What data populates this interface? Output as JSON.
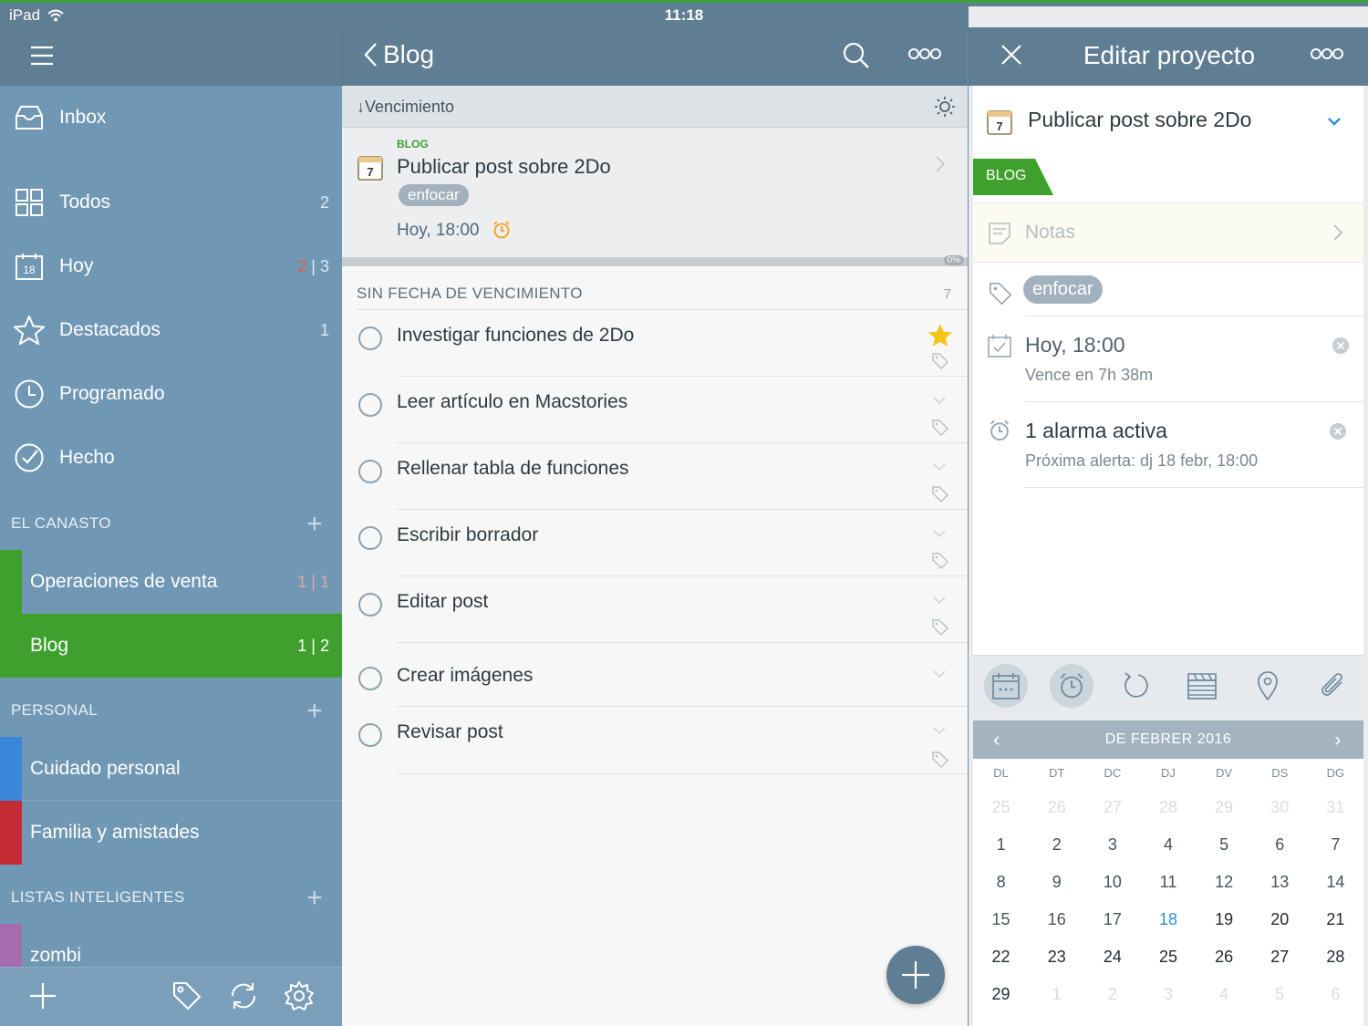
{
  "status": {
    "device": "iPad",
    "time": "11:18"
  },
  "sidebar": {
    "items": [
      {
        "label": "Inbox",
        "count": ""
      },
      {
        "label": "Todos",
        "count": "2"
      },
      {
        "label": "Hoy",
        "count_red": "2",
        "count": "3",
        "icon_text": "18"
      },
      {
        "label": "Destacados",
        "count": "1"
      },
      {
        "label": "Programado",
        "count": ""
      },
      {
        "label": "Hecho",
        "count": ""
      }
    ],
    "sections": [
      {
        "title": "EL CANASTO"
      },
      {
        "title": "PERSONAL"
      },
      {
        "title": "LISTAS INTELIGENTES"
      }
    ],
    "lists": [
      {
        "label": "Operaciones de venta",
        "count": "1 | 1",
        "color": "#3fa02e"
      },
      {
        "label": "Blog",
        "count": "1 | 2",
        "color": "#3fa02e"
      },
      {
        "label": "Cuidado personal",
        "color": "#3a86d8"
      },
      {
        "label": "Familia y amistades",
        "color": "#c42b34"
      },
      {
        "label": "zombi",
        "color": "#a46cae"
      }
    ]
  },
  "middle": {
    "back_label": "Blog",
    "sort_label": "↓Vencimiento",
    "featured": {
      "list": "BLOG",
      "title": "Publicar post sobre 2Do",
      "tag": "enfocar",
      "due": "Hoy, 18:00",
      "icon_text": "7",
      "progress": "0%"
    },
    "section_title": "SIN FECHA DE VENCIMIENTO",
    "section_count": "7",
    "tasks": [
      {
        "title": "Investigar funciones de 2Do",
        "starred": true
      },
      {
        "title": "Leer artículo en Macstories"
      },
      {
        "title": "Rellenar tabla de funciones"
      },
      {
        "title": "Escribir borrador"
      },
      {
        "title": "Editar post"
      },
      {
        "title": "Crear imágenes"
      },
      {
        "title": "Revisar post"
      }
    ]
  },
  "right": {
    "header_title": "Editar proyecto",
    "project_title": "Publicar post sobre 2Do",
    "icon_text": "7",
    "list_flag": "BLOG",
    "notes_placeholder": "Notas",
    "tag": "enfocar",
    "due": "Hoy, 18:00",
    "due_sub": "Vence en 7h 38m",
    "alarm": "1 alarma activa",
    "alarm_sub": "Próxima alerta: dj 18 febr, 18:00",
    "calendar": {
      "month": "DE FEBRER 2016",
      "weekdays": [
        "DL",
        "DT",
        "DC",
        "DJ",
        "DV",
        "DS",
        "DG"
      ],
      "prev_days": [
        "25",
        "26",
        "27",
        "28",
        "29",
        "30",
        "31"
      ],
      "next_days": [
        "1",
        "2",
        "3",
        "4",
        "5",
        "6"
      ],
      "today": "18"
    }
  },
  "colors": {
    "accent_green": "#3fa02e",
    "header": "#5f7d93",
    "sidebar": "#7098b4"
  }
}
